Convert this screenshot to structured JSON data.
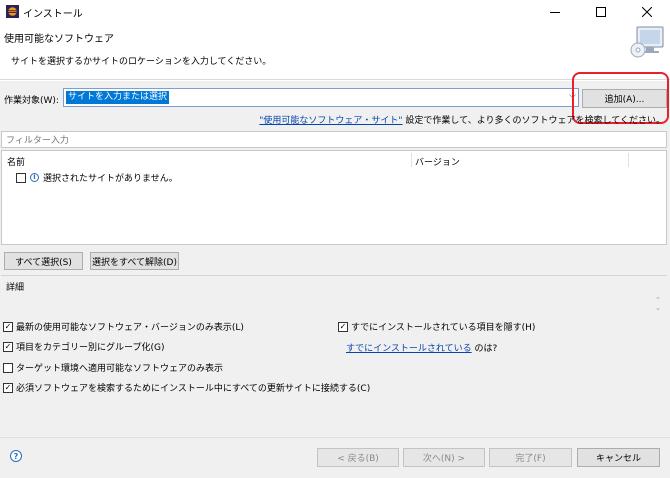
{
  "window": {
    "title": "インストール",
    "controls": [
      "minimize-icon",
      "maximize-icon",
      "close-icon"
    ]
  },
  "banner": {
    "title": "使用可能なソフトウェア",
    "description": "サイトを選択するかサイトのロケーションを入力してください。",
    "icon": "software-install-icon"
  },
  "work_with": {
    "label": "作業対象(W):",
    "value": "サイトを入力または選択",
    "add_button": "追加(A)..."
  },
  "sites_hint": {
    "link": "\"使用可能なソフトウェア・サイト\"",
    "text": " 設定で作業して、より多くのソフトウェアを検索してください。"
  },
  "filter": {
    "placeholder": "フィルター入力"
  },
  "tree": {
    "columns": [
      "名前",
      "バージョン"
    ],
    "rows": [
      {
        "checked": false,
        "icon": "info-icon",
        "label": "選択されたサイトがありません。"
      }
    ]
  },
  "selection_buttons": {
    "select_all": "すべて選択(S)",
    "deselect_all": "選択をすべて解除(D)"
  },
  "details": {
    "label": "詳細"
  },
  "options": {
    "latest_only": {
      "label": "最新の使用可能なソフトウェア・バージョンのみ表示(L)",
      "checked": true
    },
    "group_by_category": {
      "label": "項目をカテゴリー別にグループ化(G)",
      "checked": true
    },
    "target_env_only": {
      "label": "ターゲット環境へ適用可能なソフトウェアのみ表示",
      "checked": false
    },
    "contact_all_sites": {
      "label": "必須ソフトウェアを検索するためにインストール中にすべての更新サイトに接続する(C)",
      "checked": true
    },
    "hide_installed": {
      "label": "すでにインストールされている項目を隠す(H)",
      "checked": true
    }
  },
  "installed_hint": {
    "prefix": "",
    "link": "すでにインストールされている",
    "suffix": " のは?"
  },
  "footer": {
    "back": "< 戻る(B)",
    "next": "次へ(N) >",
    "finish": "完了(F)",
    "cancel": "キャンセル"
  },
  "colors": {
    "accent": "#0078d7",
    "link": "#0645ad",
    "highlight": "#e8202a",
    "body_bg": "#f0f0f0"
  }
}
